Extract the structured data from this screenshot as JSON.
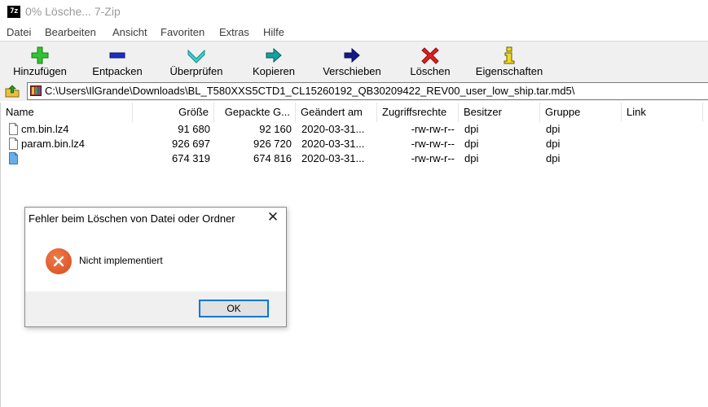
{
  "window": {
    "app_icon_text": "7z",
    "title": "0% Lösche... 7-Zip"
  },
  "menu": {
    "items": [
      "Datei",
      "Bearbeiten",
      "Ansicht",
      "Favoriten",
      "Extras",
      "Hilfe"
    ]
  },
  "toolbar": {
    "buttons": [
      {
        "label": "Hinzufügen",
        "icon": "plus-icon",
        "color": "#2fb52f"
      },
      {
        "label": "Entpacken",
        "icon": "minus-icon",
        "color": "#1d2fc4"
      },
      {
        "label": "Überprüfen",
        "icon": "check-chevron-icon",
        "color": "#33c7c7"
      },
      {
        "label": "Kopieren",
        "icon": "copy-arrow-icon",
        "color": "#0f8a8a"
      },
      {
        "label": "Verschieben",
        "icon": "move-arrow-icon",
        "color": "#141a8a"
      },
      {
        "label": "Löschen",
        "icon": "delete-x-icon",
        "color": "#e02020"
      },
      {
        "label": "Eigenschaften",
        "icon": "info-icon",
        "color": "#e8d020"
      }
    ]
  },
  "address": {
    "path": "C:\\Users\\IlGrande\\Downloads\\BL_T580XXS5CTD1_CL15260192_QB30209422_REV00_user_low_ship.tar.md5\\"
  },
  "table": {
    "columns": [
      "Name",
      "Größe",
      "Gepackte G...",
      "Geändert am",
      "Zugriffsrechte",
      "Besitzer",
      "Gruppe",
      "Link"
    ],
    "rows": [
      {
        "name": "cm.bin.lz4",
        "size": "91 680",
        "packed": "92 160",
        "modified": "2020-03-31...",
        "perms": "-rw-rw-r--",
        "owner": "dpi",
        "group": "dpi",
        "link": ""
      },
      {
        "name": "param.bin.lz4",
        "size": "926 697",
        "packed": "926 720",
        "modified": "2020-03-31...",
        "perms": "-rw-rw-r--",
        "owner": "dpi",
        "group": "dpi",
        "link": ""
      },
      {
        "name": "",
        "size": "674 319",
        "packed": "674 816",
        "modified": "2020-03-31...",
        "perms": "-rw-rw-r--",
        "owner": "dpi",
        "group": "dpi",
        "link": ""
      }
    ]
  },
  "dialog": {
    "title": "Fehler beim Löschen von Datei oder Ordner",
    "close": "✕",
    "message": "Nicht implementiert",
    "ok_label": "OK"
  }
}
